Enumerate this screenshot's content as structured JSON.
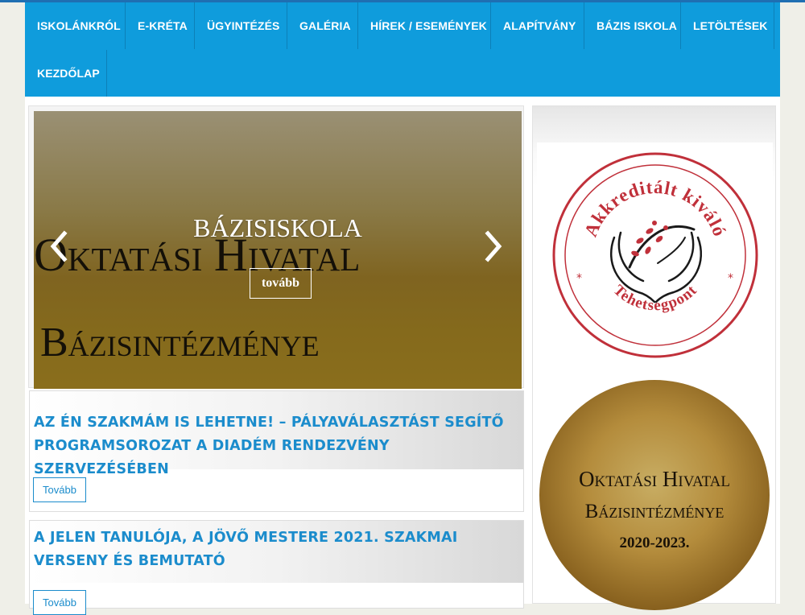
{
  "nav": {
    "items": [
      {
        "label": "ISKOLÁNKRÓL"
      },
      {
        "label": "E-KRÉTA"
      },
      {
        "label": "ÜGYINTÉZÉS"
      },
      {
        "label": "GALÉRIA"
      },
      {
        "label": "HÍREK / ESEMÉNYEK"
      },
      {
        "label": "ALAPÍTVÁNY"
      },
      {
        "label": "BÁZIS ISKOLA"
      },
      {
        "label": "LETÖLTÉSEK"
      },
      {
        "label": "KEZDŐLAP"
      }
    ]
  },
  "slider": {
    "caption": "BÁZISISKOLA",
    "more_label": "tovább",
    "background_line1": "Oktatási Hivatal",
    "background_line2": "Bázisintézménye",
    "prev_icon": "chevron-left-icon",
    "next_icon": "chevron-right-icon"
  },
  "articles": [
    {
      "title": "AZ ÉN SZAKMÁM IS LEHETNE! – PÁLYAVÁLASZTÁST SEGÍTŐ PROGRAMSOROZAT A DIADÉM RENDEZVÉNY SZERVEZÉSÉBEN",
      "more_label": "Tovább"
    },
    {
      "title": "A JELEN TANULÓJA, A JÖVŐ MESTERE 2021. SZAKMAI VERSENY ÉS BEMUTATÓ",
      "more_label": "Tovább"
    }
  ],
  "sidebar": {
    "badge": {
      "top_text": "Akkreditált kiváló",
      "bottom_text": "Tehetségpont"
    },
    "medal": {
      "line1": "Oktatási Hivatal",
      "line2": "Bázisintézménye",
      "line3": "2020-2023."
    }
  },
  "colors": {
    "nav_bg": "#0f9cdc",
    "accent": "#1b8ccc",
    "badge_red": "#c0303a"
  }
}
